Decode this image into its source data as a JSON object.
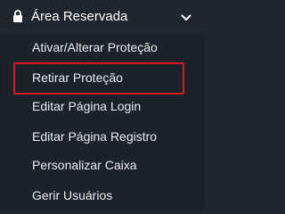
{
  "section": {
    "title": "Área Reservada",
    "icon": "lock-icon",
    "toggle_icon": "chevron-down-icon",
    "expanded": true
  },
  "submenu": {
    "items": [
      {
        "label": "Ativar/Alterar Proteção"
      },
      {
        "label": "Retirar Proteção",
        "highlighted": true
      },
      {
        "label": "Editar Página Login"
      },
      {
        "label": "Editar Página Registro"
      },
      {
        "label": "Personalizar Caixa"
      },
      {
        "label": "Gerir Usuários"
      }
    ]
  },
  "colors": {
    "background": "#1f272d",
    "submenu_background": "#1c2328",
    "text": "#e8ecef",
    "highlight_border": "#d9182b"
  }
}
